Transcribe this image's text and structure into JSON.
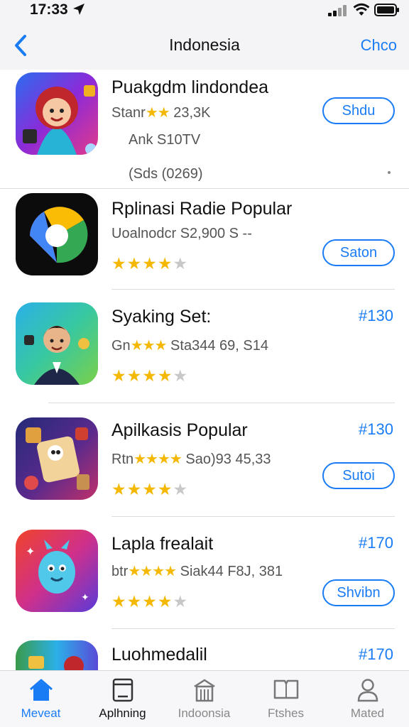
{
  "status_bar": {
    "time": "17:33"
  },
  "nav": {
    "title": "Indonesia",
    "action": "Chco"
  },
  "apps": [
    {
      "name": "Puakgdm lindondea",
      "sub_prefix": "Stanr",
      "sub_suffix": "23,3K",
      "extra1": "Ank S10TV",
      "extra2": "(Sds (0269)",
      "button": "Shdu"
    },
    {
      "name": "Rplinasi Radie Popular",
      "sub": "Uoalnodcr S2,900 S --",
      "stars": 4,
      "button": "Saton"
    },
    {
      "name": "Syaking Set:",
      "sub_prefix": "Gn",
      "sub_suffix": "Sta344 69, S14",
      "stars": 4,
      "price": "#130"
    },
    {
      "name": "Apilkasis Popular",
      "sub_prefix": "Rtn",
      "sub_suffix": "Sao)93 45,33",
      "stars": 4,
      "price": "#130",
      "button": "Sutoi"
    },
    {
      "name": "Lapla frealait",
      "sub_prefix": "btr",
      "sub_suffix": "Siak44 F8J, 381",
      "stars": 4,
      "price": "#170",
      "button": "Shvibn"
    },
    {
      "name": "Luohmedalil",
      "price": "#170"
    }
  ],
  "tabs": [
    {
      "label": "Meveat",
      "icon": "home-icon",
      "active": true
    },
    {
      "label": "Aplhning",
      "icon": "tablet-icon"
    },
    {
      "label": "Indoonsia",
      "icon": "building-icon"
    },
    {
      "label": "Ftshes",
      "icon": "book-icon"
    },
    {
      "label": "Mated",
      "icon": "person-icon"
    }
  ],
  "colors": {
    "accent": "#1a7cf5",
    "star": "#f5b800",
    "star_off": "#c8c8c8"
  }
}
